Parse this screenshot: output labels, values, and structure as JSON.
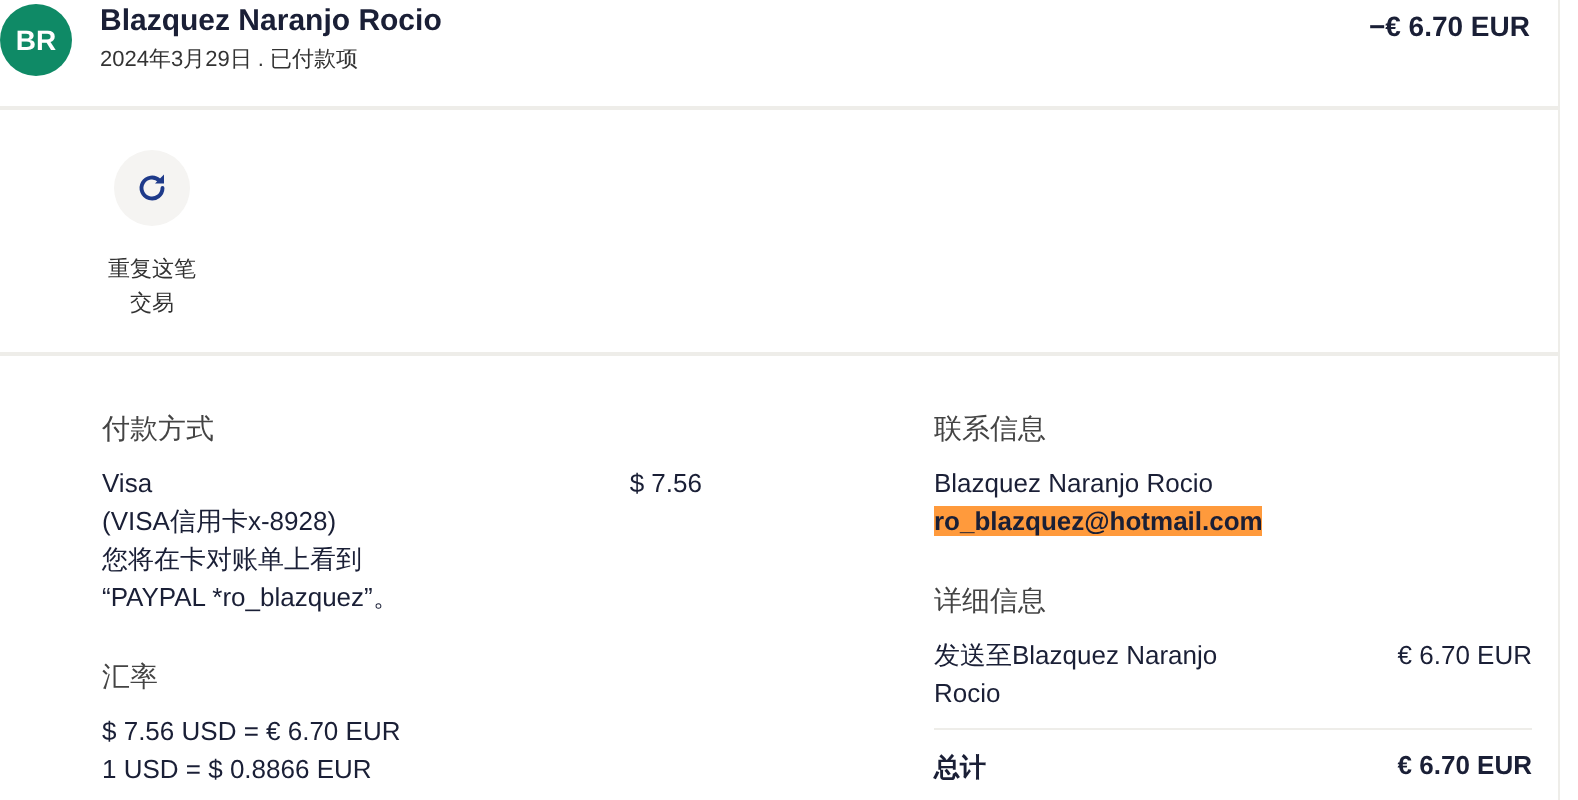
{
  "header": {
    "avatar_initials": "BR",
    "name": "Blazquez Naranjo Rocio",
    "subtitle": "2024年3月29日 . 已付款项",
    "amount": "−€ 6.70 EUR"
  },
  "actions": [
    {
      "kind": "repeat",
      "label": "重复这笔交易"
    }
  ],
  "payment": {
    "title": "付款方式",
    "method": "Visa",
    "amount": "$ 7.56",
    "card": "(VISA信用卡x-8928)",
    "statement_note": "您将在卡对账单上看到\n“PAYPAL *ro_blazquez”。"
  },
  "exchange": {
    "title": "汇率",
    "lines": [
      "$ 7.56 USD = € 6.70 EUR",
      "1 USD = $ 0.8866 EUR"
    ]
  },
  "contact": {
    "title": "联系信息",
    "name": "Blazquez Naranjo Rocio",
    "email": "ro_blazquez@hotmail.com",
    "email_highlighted": true
  },
  "details": {
    "title": "详细信息",
    "rows": [
      {
        "label": "发送至Blazquez Naranjo Rocio",
        "amount": "€ 6.70 EUR"
      }
    ],
    "total_label": "总计",
    "total_amount": "€ 6.70 EUR"
  }
}
